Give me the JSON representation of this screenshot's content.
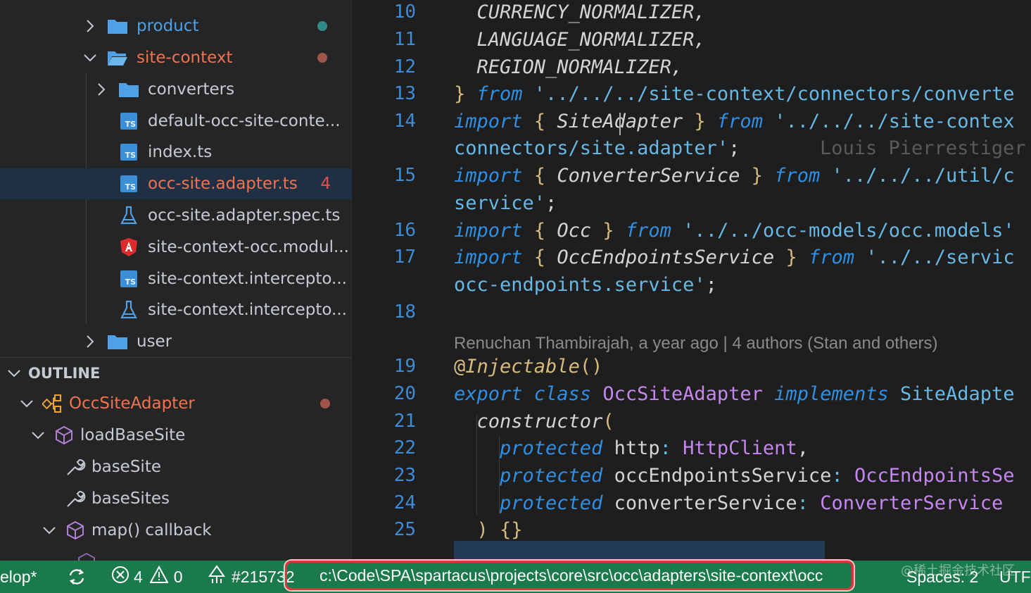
{
  "explorer": {
    "items": [
      {
        "label": "product",
        "kind": "folder",
        "expanded": false,
        "color": "#4ea1e6",
        "dot": "#2f8a8a"
      },
      {
        "label": "site-context",
        "kind": "folder-open",
        "expanded": true,
        "color": "#f0734f",
        "dot": "#a0544a"
      },
      {
        "label": "converters",
        "kind": "folder",
        "expanded": false,
        "color": "#c5cad3"
      },
      {
        "label": "default-occ-site-conte...",
        "kind": "ts",
        "color": "#c5cad3"
      },
      {
        "label": "index.ts",
        "kind": "ts",
        "color": "#c5cad3"
      },
      {
        "label": "occ-site.adapter.ts",
        "kind": "ts",
        "color": "#f0734f",
        "badge": "4"
      },
      {
        "label": "occ-site.adapter.spec.ts",
        "kind": "test",
        "color": "#c5cad3"
      },
      {
        "label": "site-context-occ.modul...",
        "kind": "angular",
        "color": "#c5cad3"
      },
      {
        "label": "site-context.intercepto...",
        "kind": "ts",
        "color": "#c5cad3"
      },
      {
        "label": "site-context.intercepto...",
        "kind": "test",
        "color": "#c5cad3"
      },
      {
        "label": "user",
        "kind": "folder",
        "expanded": false,
        "color": "#c5cad3"
      }
    ]
  },
  "outline": {
    "title": "OUTLINE",
    "items": [
      {
        "label": "OccSiteAdapter",
        "kind": "class",
        "color": "#f0734f",
        "dot": "#a0544a"
      },
      {
        "label": "loadBaseSite",
        "kind": "method",
        "color": "#c5cad3"
      },
      {
        "label": "baseSite",
        "kind": "wrench",
        "color": "#c5cad3"
      },
      {
        "label": "baseSites",
        "kind": "wrench",
        "color": "#c5cad3"
      },
      {
        "label": "map() callback",
        "kind": "method",
        "color": "#c5cad3"
      }
    ]
  },
  "editor": {
    "line_numbers": [
      "10",
      "11",
      "12",
      "13",
      "14",
      "",
      "15",
      "",
      "16",
      "17",
      "",
      "18",
      "19",
      "20",
      "21",
      "22",
      "23",
      "24",
      "25"
    ],
    "code": {
      "l10": "  CURRENCY_NORMALIZER,",
      "l11": "  LANGUAGE_NORMALIZER,",
      "l12": "  REGION_NORMALIZER,",
      "l13a": "} ",
      "l13b": "from",
      "l13c": " '../../../site-context/connectors/converte",
      "l14a": "import",
      "l14b": " { ",
      "l14c": "SiteAdapter",
      "l14d": " } ",
      "l14e": "from",
      "l14f": " '../../../site-contex",
      "l14g": "connectors/site.adapter'",
      "l14h": ";",
      "blame": "Louis Pierrestiger",
      "l15a": "import",
      "l15b": " { ",
      "l15c": "ConverterService",
      "l15d": " } ",
      "l15e": "from",
      "l15f": " '../../../util/c",
      "l15g": "service'",
      "l15h": ";",
      "l16a": "import",
      "l16b": " { ",
      "l16c": "Occ",
      "l16d": " } ",
      "l16e": "from",
      "l16f": " '../../occ-models/occ.models'",
      "l17a": "import",
      "l17b": " { ",
      "l17c": "OccEndpointsService",
      "l17d": " } ",
      "l17e": "from",
      "l17f": " '../../servic",
      "l17g": "occ-endpoints.service'",
      "l17h": ";",
      "lens": "Renuchan Thambirajah, a year ago | 4 authors (Stan and others)",
      "l19a": "@",
      "l19b": "Injectable",
      "l19c": "()",
      "l20a": "export class",
      "l20b": " OccSiteAdapter",
      "l20c": " implements",
      "l20d": " SiteAdapte",
      "l21a": "  constructor",
      "l21b": "(",
      "l22a": "    protected",
      "l22b": " http",
      "l22c": ":",
      "l22d": " HttpClient",
      "l22e": ",",
      "l23a": "    protected",
      "l23b": " occEndpointsService",
      "l23c": ":",
      "l23d": " OccEndpointsSe",
      "l24a": "    protected",
      "l24b": " converterService",
      "l24c": ":",
      "l24d": " ConverterService",
      "l25a": "  ) ",
      "l25b": "{}"
    }
  },
  "statusbar": {
    "branch": "elop*",
    "sync_icon": "sync-icon",
    "errors": "4",
    "warnings": "0",
    "pr": "#215732",
    "path": "c:\\Code\\SPA\\spartacus\\projects\\core\\src\\occ\\adapters\\site-context\\occ",
    "spaces": "Spaces: 2",
    "encoding": "UTF-",
    "watermark": "@稀土掘金技术社区"
  },
  "colors": {
    "statusbar_bg": "#1a7a4c",
    "highlight_border": "#e0333a",
    "keyword": "#2f8fe3",
    "string": "#68b8e6",
    "class": "#c586f0"
  }
}
